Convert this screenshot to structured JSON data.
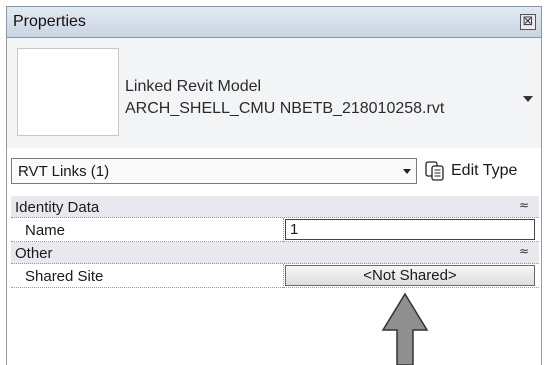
{
  "panel": {
    "title": "Properties",
    "close_glyph": "⊠"
  },
  "type_selector": {
    "category": "Linked Revit Model",
    "file": "ARCH_SHELL_CMU NBETB_218010258.rvt"
  },
  "instance_selector": {
    "value": "RVT Links (1)"
  },
  "edit_type": {
    "label": "Edit Type",
    "icon": "edit-type-icon"
  },
  "sections": {
    "identity": {
      "title": "Identity Data",
      "chevron": "≈",
      "name_label": "Name",
      "name_value": "1"
    },
    "other": {
      "title": "Other",
      "chevron": "≈",
      "shared_site_label": "Shared Site",
      "shared_site_value": "<Not Shared>"
    }
  }
}
